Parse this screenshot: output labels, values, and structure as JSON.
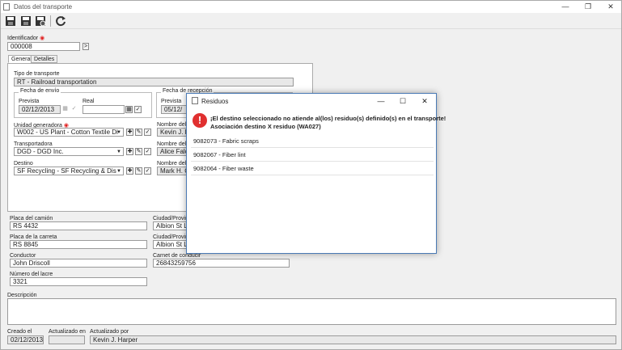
{
  "window": {
    "title": "Datos del transporte",
    "minimize": "—",
    "maximize": "❐",
    "close": "✕"
  },
  "toolbar": {
    "save_icon": "save-icon",
    "save_new_icon": "save-new-icon",
    "save_close_icon": "save-close-icon",
    "refresh_icon": "refresh-icon"
  },
  "identificador": {
    "label": "Identificador",
    "value": "000008",
    "next": ">"
  },
  "tabs": [
    {
      "label": "General"
    },
    {
      "label": "Detalles"
    }
  ],
  "tipo_transporte": {
    "label": "Tipo de transporte",
    "value": "RT - Railroad transportation"
  },
  "fecha_envio": {
    "label": "Fecha de envío",
    "prevista_label": "Prevista",
    "prevista_value": "02/12/2013",
    "real_label": "Real",
    "real_value": ""
  },
  "fecha_recepcion": {
    "label": "Fecha de recepción",
    "prevista_label": "Prevista",
    "prevista_value": "05/12/"
  },
  "unidad_generadora": {
    "label": "Unidad generadora",
    "value": "W002 - US Plant - Cotton Textile Di"
  },
  "nombre1": {
    "label": "Nombre del r",
    "value": "Kevin J. H"
  },
  "transportadora": {
    "label": "Transportadora",
    "value": "DGD - DGD Inc."
  },
  "nombre2": {
    "label": "Nombre del r",
    "value": "Alice Falc"
  },
  "destino": {
    "label": "Destino",
    "value": "SF Recycling - SF Recycling & Dis"
  },
  "nombre3": {
    "label": "Nombre del r",
    "value": "Mark H. C"
  },
  "placa_camion": {
    "label": "Placa del camión",
    "value": "RS 4432"
  },
  "ciudad1": {
    "label": "Ciudad/Provin",
    "value": "Albion St L"
  },
  "placa_carreta": {
    "label": "Placa de la carreta",
    "value": "RS 8845"
  },
  "ciudad2": {
    "label": "Ciudad/Provin",
    "value": "Albion St L"
  },
  "conductor": {
    "label": "Conductor",
    "value": "John Driscoll"
  },
  "carnet": {
    "label": "Carnet de conducir",
    "value": "26843259756"
  },
  "lacre": {
    "label": "Número del lacre",
    "value": "3321"
  },
  "descripcion": {
    "label": "Descripción",
    "value": ""
  },
  "footer": {
    "creado_label": "Creado el",
    "creado_value": "02/12/2013",
    "actualizado_label": "Actualizado en",
    "actualizado_value": "",
    "por_label": "Actualizado por",
    "por_value": "Kevin J. Harper"
  },
  "dialog": {
    "title": "Residuos",
    "minimize": "—",
    "maximize": "☐",
    "close": "✕",
    "message_line1": "¡El destino seleccionado no atiende al(los) residuo(s) definido(s) en el transporte!",
    "message_line2": "Asociación destino X residuo (WA027)",
    "error_glyph": "!",
    "items": [
      "9082073 - Fabric scraps",
      "9082067 - Fiber lint",
      "9082064 - Fiber waste"
    ]
  }
}
